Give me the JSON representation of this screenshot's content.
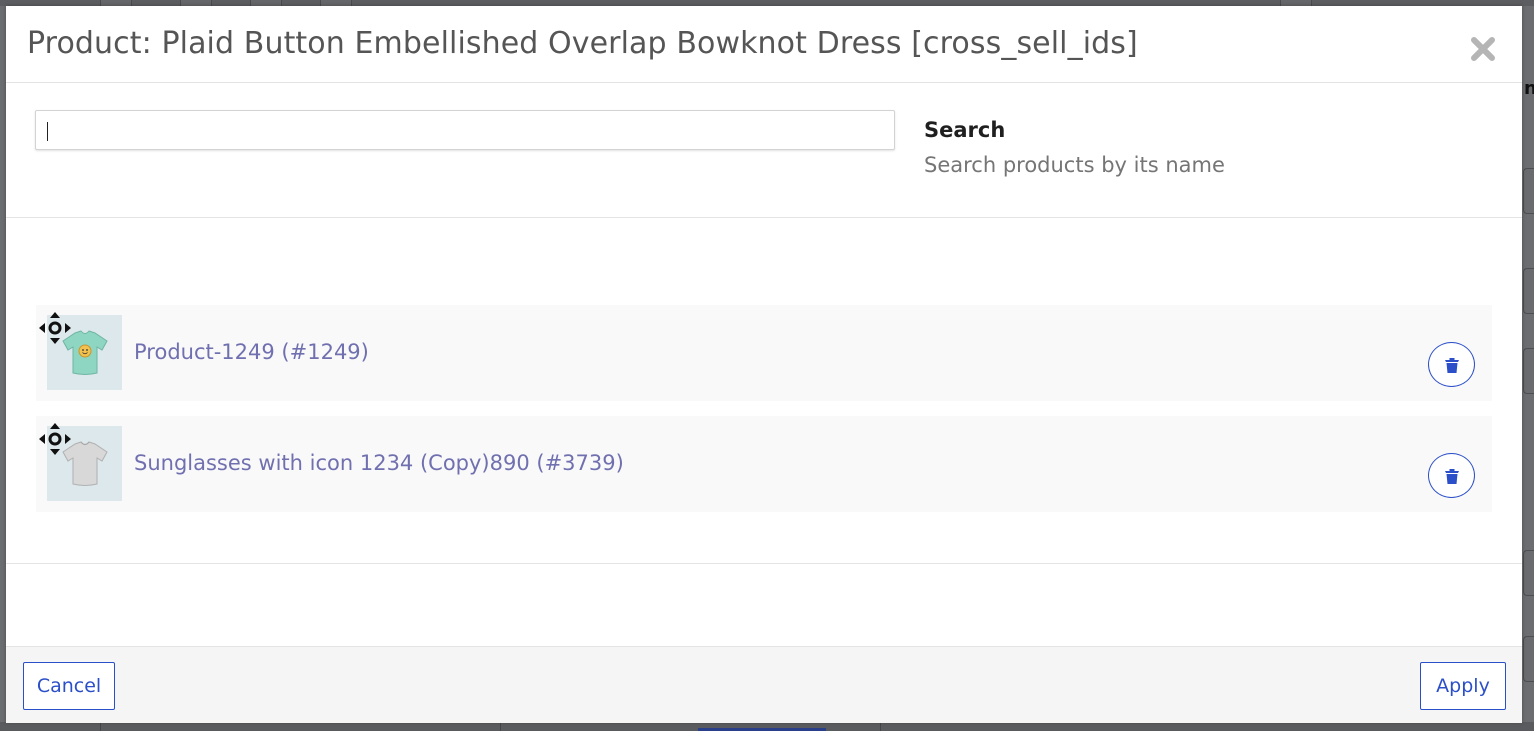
{
  "modal": {
    "title": "Product: Plaid Button Embellished Overlap Bowknot Dress [cross_sell_ids]",
    "close_icon": "close-icon"
  },
  "search": {
    "value": "",
    "label": "Search",
    "help": "Search products by its name"
  },
  "items": [
    {
      "label": "Product-1249 (#1249)",
      "thumbnail": "mint-tshirt-thumbnail",
      "move_icon": "move-icon",
      "delete_icon": "trash-icon"
    },
    {
      "label": "Sunglasses with icon 1234 (Copy)890 (#3739)",
      "thumbnail": "gray-tshirt-thumbnail",
      "move_icon": "move-icon",
      "delete_icon": "trash-icon"
    }
  ],
  "footer": {
    "cancel_label": "Cancel",
    "apply_label": "Apply"
  },
  "colors": {
    "accent": "#2b4fc9",
    "link": "#7070b0",
    "title": "#555555",
    "muted": "#757575"
  }
}
